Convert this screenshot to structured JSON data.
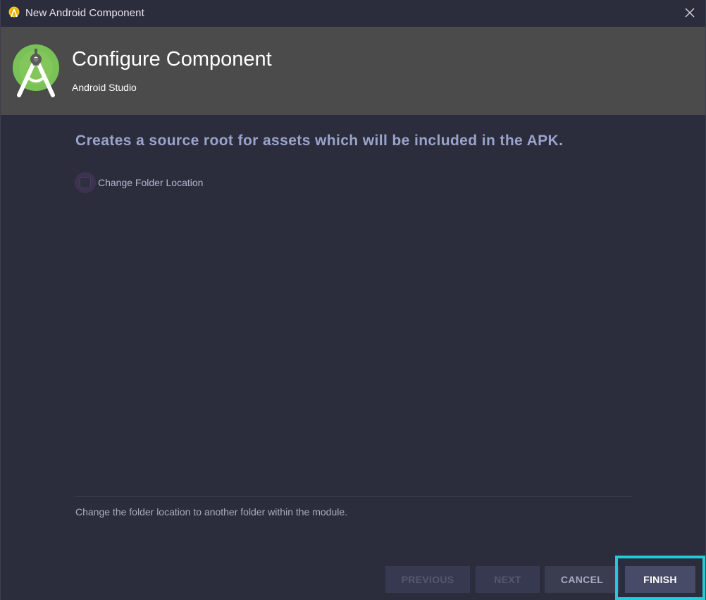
{
  "window": {
    "title": "New Android Component",
    "close_icon": "close-icon",
    "app_icon": "android-studio-app-icon"
  },
  "header": {
    "title": "Configure Component",
    "subtitle": "Android Studio",
    "logo_icon": "android-studio-logo-icon",
    "background_color": "#4b4b4b"
  },
  "content": {
    "description": "Creates a source root for assets which will be included in the APK.",
    "change_folder_checkbox": {
      "label": "Change Folder Location",
      "checked": false
    },
    "help_text": "Change the folder location to another folder within the module."
  },
  "footer": {
    "previous_label": "PREVIOUS",
    "next_label": "NEXT",
    "cancel_label": "CANCEL",
    "finish_label": "FINISH",
    "highlight_color": "#22cbd6"
  },
  "colors": {
    "background": "#2b2d3d",
    "accent_text": "#9aa3c9"
  }
}
